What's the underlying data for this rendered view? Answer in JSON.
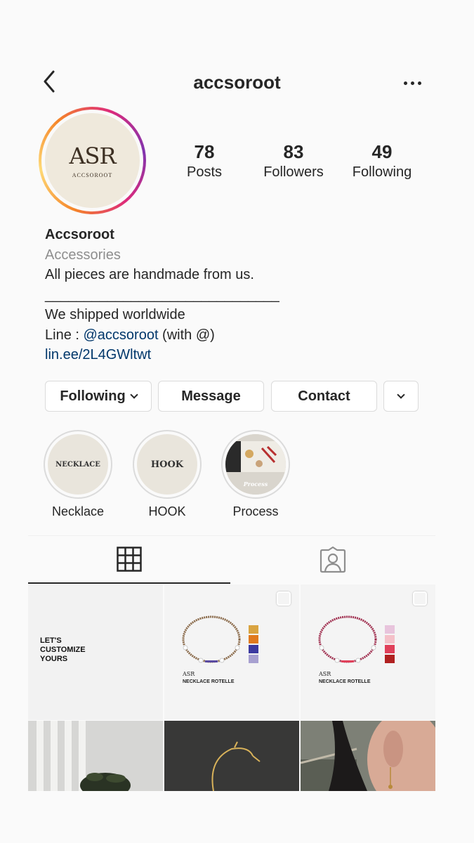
{
  "header": {
    "username": "accsoroot",
    "back_icon": "chevron-left-icon",
    "more_icon": "more-horizontal-icon"
  },
  "profile": {
    "avatar_logo": "ASR",
    "avatar_subtext": "ACCSOROOT",
    "stats": {
      "posts": {
        "value": "78",
        "label": "Posts"
      },
      "followers": {
        "value": "83",
        "label": "Followers"
      },
      "following": {
        "value": "49",
        "label": "Following"
      }
    },
    "bio": {
      "name": "Accsoroot",
      "category": "Accessories",
      "line1": "All pieces are handmade from us.",
      "line2": "______________________________",
      "line3": "We shipped worldwide",
      "line4_prefix": "Line : ",
      "line4_mention": "@accsoroot",
      "line4_suffix": " (with @)",
      "link": "lin.ee/2L4GWltwt"
    }
  },
  "actions": {
    "following": "Following",
    "message": "Message",
    "contact": "Contact"
  },
  "highlights": [
    {
      "label": "Necklace",
      "cover_text": "NECKLACE"
    },
    {
      "label": "HOOK",
      "cover_text": "HOOK"
    },
    {
      "label": "Process",
      "cover_text": "Process"
    }
  ],
  "tabs": {
    "grid_icon": "grid-icon",
    "tagged_icon": "tagged-person-icon"
  },
  "posts": {
    "p1_text": "LET'S\nCUSTOMIZE\nYOURS",
    "nk_logo": "ASR",
    "nk_title": "NECKLACE ROTELLE",
    "p2_swatches": [
      {
        "color": "#d9a441",
        "label": "#d9a441"
      },
      {
        "color": "#e07a1f",
        "label": "#e07a1f"
      },
      {
        "color": "#3c3aa0",
        "label": "#3c3aa0"
      },
      {
        "color": "#a7a0d0",
        "label": "#a7a0d0"
      }
    ],
    "p3_swatches": [
      {
        "color": "#e8c4dc",
        "label": "#e8c4dc"
      },
      {
        "color": "#f4c0c8",
        "label": "#f4c0c8"
      },
      {
        "color": "#e0405a",
        "label": "#e0405a"
      },
      {
        "color": "#b02020",
        "label": "#b02020"
      }
    ]
  },
  "colors": {
    "link": "#00376b",
    "muted": "#8e8e8e",
    "border": "#dbdbdb"
  }
}
